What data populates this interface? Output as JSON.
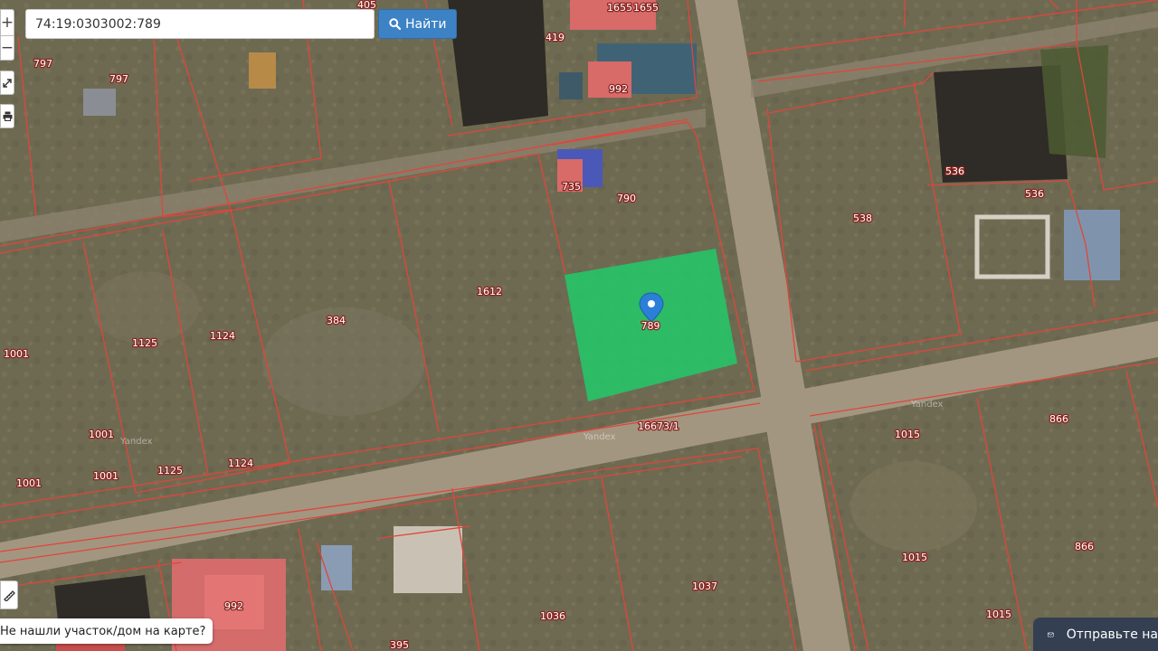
{
  "search": {
    "query": "74:19:0303002:789",
    "button_label": "Найти"
  },
  "map_controls": {
    "zoom_in": "+",
    "zoom_out": "−"
  },
  "help_link": "Не нашли участок/дом на карте?",
  "chat_widget": {
    "label": "Отправьте на"
  },
  "selected_parcel": {
    "number": "789",
    "fill_color": "#22c96a"
  },
  "colors": {
    "boundary": "#e0453c",
    "selection": "#22c96a",
    "search_button": "#3d82c5",
    "chat_widget": "#343f52"
  },
  "parcels": {
    "p405": "405",
    "p1655a": "1655",
    "p1655b": "1655",
    "p797a": "797",
    "p797b": "797",
    "p419": "419",
    "p992a": "992",
    "p536a": "536",
    "p536b": "536",
    "p735": "735",
    "p790": "790",
    "p538": "538",
    "p1612": "1612",
    "p384": "384",
    "p1001a": "1001",
    "p1125a": "1125",
    "p1124a": "1124",
    "p1001b": "1001",
    "p1001c": "1001",
    "p1001d": "1001",
    "p1125b": "1125",
    "p1124b": "1124",
    "p16673": "16673/1",
    "p1015a": "1015",
    "p866a": "866",
    "p1015b": "1015",
    "p866b": "866",
    "p1015c": "1015",
    "p1037": "1037",
    "p1036": "1036",
    "p992b": "992",
    "p395": "395"
  },
  "watermarks": {
    "w1": "Yandex",
    "w2": "Yandex",
    "w3": "Yandex"
  }
}
